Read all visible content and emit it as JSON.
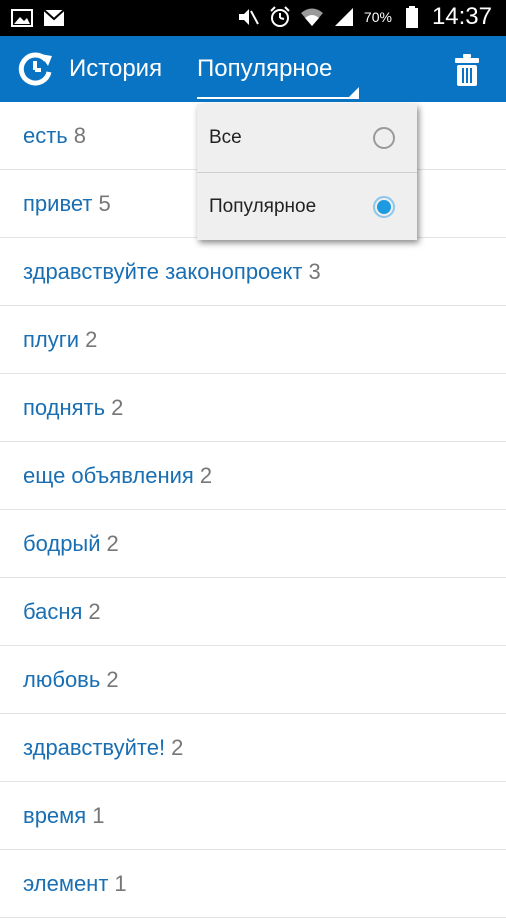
{
  "status_bar": {
    "icons_left": [
      "gallery-icon",
      "gmail-icon"
    ],
    "icons_right": [
      "mute-icon",
      "alarm-icon",
      "wifi-icon",
      "signal-icon"
    ],
    "battery": "70%",
    "time": "14:37"
  },
  "action_bar": {
    "title": "История",
    "spinner_value": "Популярное",
    "color": "#0a74c4"
  },
  "dropdown": {
    "options": [
      {
        "label": "Все",
        "selected": false
      },
      {
        "label": "Популярное",
        "selected": true
      }
    ]
  },
  "history": [
    {
      "word": "есть",
      "count": "8"
    },
    {
      "word": "привет",
      "count": "5"
    },
    {
      "word": "здравствуйте законопроект",
      "count": "3"
    },
    {
      "word": "плуги",
      "count": "2"
    },
    {
      "word": "поднять",
      "count": "2"
    },
    {
      "word": "еще объявления",
      "count": "2"
    },
    {
      "word": "бодрый",
      "count": "2"
    },
    {
      "word": "басня",
      "count": "2"
    },
    {
      "word": "любовь",
      "count": "2"
    },
    {
      "word": "здравствуйте!",
      "count": "2"
    },
    {
      "word": "время",
      "count": "1"
    },
    {
      "word": "элемент",
      "count": "1"
    }
  ]
}
